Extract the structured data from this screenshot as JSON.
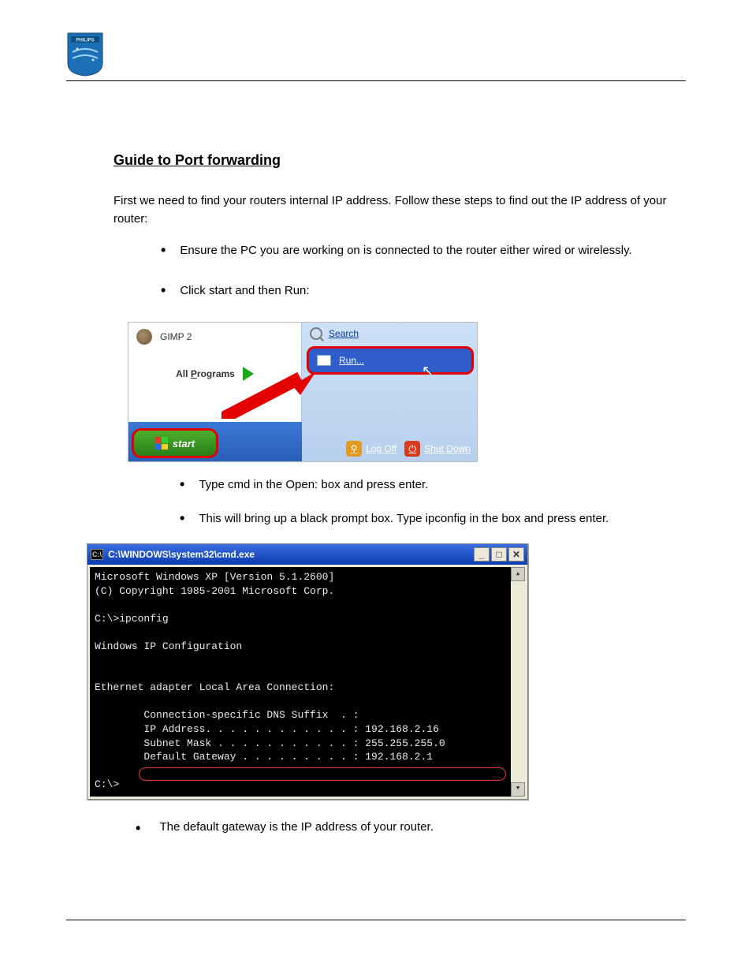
{
  "logo_alt": "Philips",
  "section": {
    "heading": "Guide to Port forwarding",
    "intro": "First we need to find your routers internal IP address. Follow these steps to find out the IP address of your router:",
    "steps": [
      "Ensure the PC you are working on is connected to the router either wired or wirelessly.",
      "Click start and then Run:"
    ],
    "steps_after_img1": [
      "Type cmd in the Open: box and press enter.",
      "This will bring up a black prompt box. Type ipconfig in the box and press enter."
    ],
    "final_bullet": "The default gateway is the IP address of your router."
  },
  "startmenu": {
    "gimp_label": "GIMP 2",
    "all_programs_pre": "All ",
    "all_programs_u": "P",
    "all_programs_post": "rograms",
    "search_u": "S",
    "search_post": "earch",
    "run_u": "R",
    "run_post": "un...",
    "logoff_u": "L",
    "logoff_post": "og Off",
    "shutdown_pre": "Sh",
    "shutdown_u": "u",
    "shutdown_post": "t Down",
    "start_label": "start"
  },
  "cmd": {
    "title_prefix": "C:\\",
    "title": "C:\\WINDOWS\\system32\\cmd.exe",
    "line1": "Microsoft Windows XP [Version 5.1.2600]",
    "line2": "(C) Copyright 1985-2001 Microsoft Corp.",
    "prompt1": "C:\\>ipconfig",
    "header": "Windows IP Configuration",
    "adapter": "Ethernet adapter Local Area Connection:",
    "dns": "        Connection-specific DNS Suffix  . :",
    "ip": "        IP Address. . . . . . . . . . . . : 192.168.2.16",
    "mask": "        Subnet Mask . . . . . . . . . . . : 255.255.255.0",
    "gw": "        Default Gateway . . . . . . . . . : 192.168.2.1",
    "prompt2": "C:\\>"
  }
}
